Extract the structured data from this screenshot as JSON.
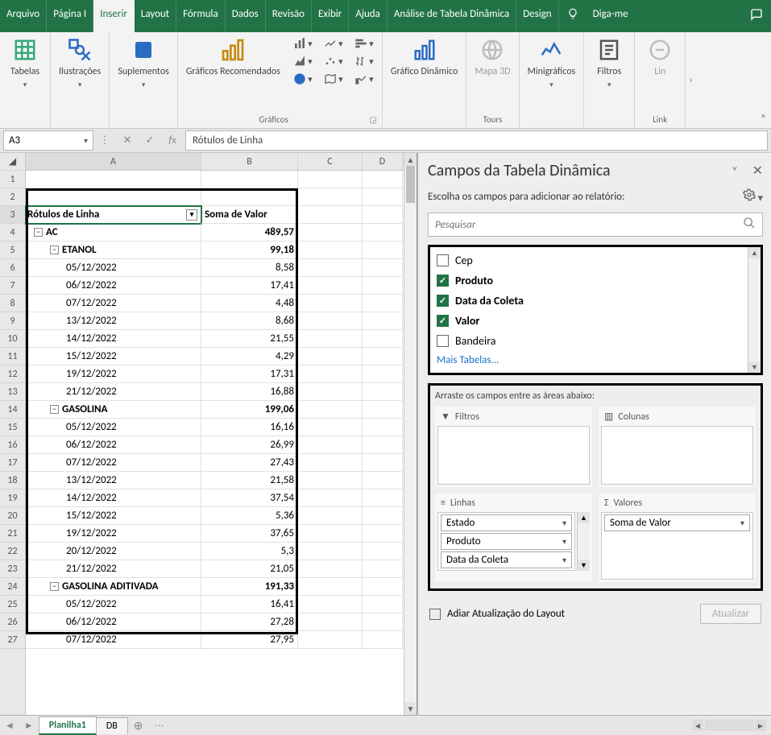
{
  "menus": {
    "arquivo": "Arquivo",
    "pagina": "Página I",
    "inserir": "Inserir",
    "layout": "Layout",
    "formula": "Fórmula",
    "dados": "Dados",
    "revisao": "Revisão",
    "exibir": "Exibir",
    "ajuda": "Ajuda",
    "analise": "Análise de Tabela Dinâmica",
    "design": "Design",
    "digame": "Diga-me"
  },
  "ribbon": {
    "tabelas": "Tabelas",
    "ilustracoes": "Ilustrações",
    "suplementos": "Suplementos",
    "graficos_rec": "Gráficos Recomendados",
    "grafico_din": "Gráfico Dinâmico",
    "mapa3d": "Mapa 3D",
    "minigraficos": "Minigráficos",
    "filtros": "Filtros",
    "link": "Lin",
    "grp_graficos": "Gráficos",
    "grp_tours": "Tours",
    "grp_link": "Link"
  },
  "namebox": "A3",
  "formula": "Rótulos de Linha",
  "columns": [
    "A",
    "B",
    "C",
    "D"
  ],
  "rows": [
    {
      "n": 1
    },
    {
      "n": 2
    },
    {
      "n": 3,
      "a": "Rótulos de Linha",
      "b": "Soma de Valor",
      "hdr": true,
      "filter": true,
      "sel": true
    },
    {
      "n": 4,
      "a": "AC",
      "b": "489,57",
      "lvl": 0,
      "bold": true,
      "col": true
    },
    {
      "n": 5,
      "a": "ETANOL",
      "b": "99,18",
      "lvl": 1,
      "bold": true,
      "col": true
    },
    {
      "n": 6,
      "a": "05/12/2022",
      "b": "8,58",
      "lvl": 2
    },
    {
      "n": 7,
      "a": "06/12/2022",
      "b": "17,41",
      "lvl": 2
    },
    {
      "n": 8,
      "a": "07/12/2022",
      "b": "4,48",
      "lvl": 2
    },
    {
      "n": 9,
      "a": "13/12/2022",
      "b": "8,68",
      "lvl": 2
    },
    {
      "n": 10,
      "a": "14/12/2022",
      "b": "21,55",
      "lvl": 2
    },
    {
      "n": 11,
      "a": "15/12/2022",
      "b": "4,29",
      "lvl": 2
    },
    {
      "n": 12,
      "a": "19/12/2022",
      "b": "17,31",
      "lvl": 2
    },
    {
      "n": 13,
      "a": "21/12/2022",
      "b": "16,88",
      "lvl": 2
    },
    {
      "n": 14,
      "a": "GASOLINA",
      "b": "199,06",
      "lvl": 1,
      "bold": true,
      "col": true
    },
    {
      "n": 15,
      "a": "05/12/2022",
      "b": "16,16",
      "lvl": 2
    },
    {
      "n": 16,
      "a": "06/12/2022",
      "b": "26,99",
      "lvl": 2
    },
    {
      "n": 17,
      "a": "07/12/2022",
      "b": "27,43",
      "lvl": 2
    },
    {
      "n": 18,
      "a": "13/12/2022",
      "b": "21,58",
      "lvl": 2
    },
    {
      "n": 19,
      "a": "14/12/2022",
      "b": "37,54",
      "lvl": 2
    },
    {
      "n": 20,
      "a": "15/12/2022",
      "b": "5,36",
      "lvl": 2
    },
    {
      "n": 21,
      "a": "19/12/2022",
      "b": "37,65",
      "lvl": 2
    },
    {
      "n": 22,
      "a": "20/12/2022",
      "b": "5,3",
      "lvl": 2
    },
    {
      "n": 23,
      "a": "21/12/2022",
      "b": "21,05",
      "lvl": 2
    },
    {
      "n": 24,
      "a": "GASOLINA ADITIVADA",
      "b": "191,33",
      "lvl": 1,
      "bold": true,
      "col": true
    },
    {
      "n": 25,
      "a": "05/12/2022",
      "b": "16,41",
      "lvl": 2
    },
    {
      "n": 26,
      "a": "06/12/2022",
      "b": "27,28",
      "lvl": 2
    },
    {
      "n": 27,
      "a": "07/12/2022",
      "b": "27,95",
      "lvl": 2
    }
  ],
  "pane": {
    "title": "Campos da Tabela Dinâmica",
    "sub": "Escolha os campos para adicionar ao relatório:",
    "search_ph": "Pesquisar",
    "fields": [
      {
        "name": "Cep",
        "checked": false
      },
      {
        "name": "Produto",
        "checked": true
      },
      {
        "name": "Data da Coleta",
        "checked": true
      },
      {
        "name": "Valor",
        "checked": true
      },
      {
        "name": "Bandeira",
        "checked": false
      }
    ],
    "more": "Mais Tabelas...",
    "drag_instr": "Arraste os campos entre as áreas abaixo:",
    "area_filtros": "Filtros",
    "area_colunas": "Colunas",
    "area_linhas": "Linhas",
    "area_valores": "Valores",
    "linhas_items": [
      "Estado",
      "Produto",
      "Data da Coleta"
    ],
    "valores_items": [
      "Soma de Valor"
    ],
    "defer": "Adiar Atualização do Layout",
    "update": "Atualizar",
    "sigma": "Σ"
  },
  "sheets": {
    "planilha1": "Planilha1",
    "db": "DB"
  }
}
